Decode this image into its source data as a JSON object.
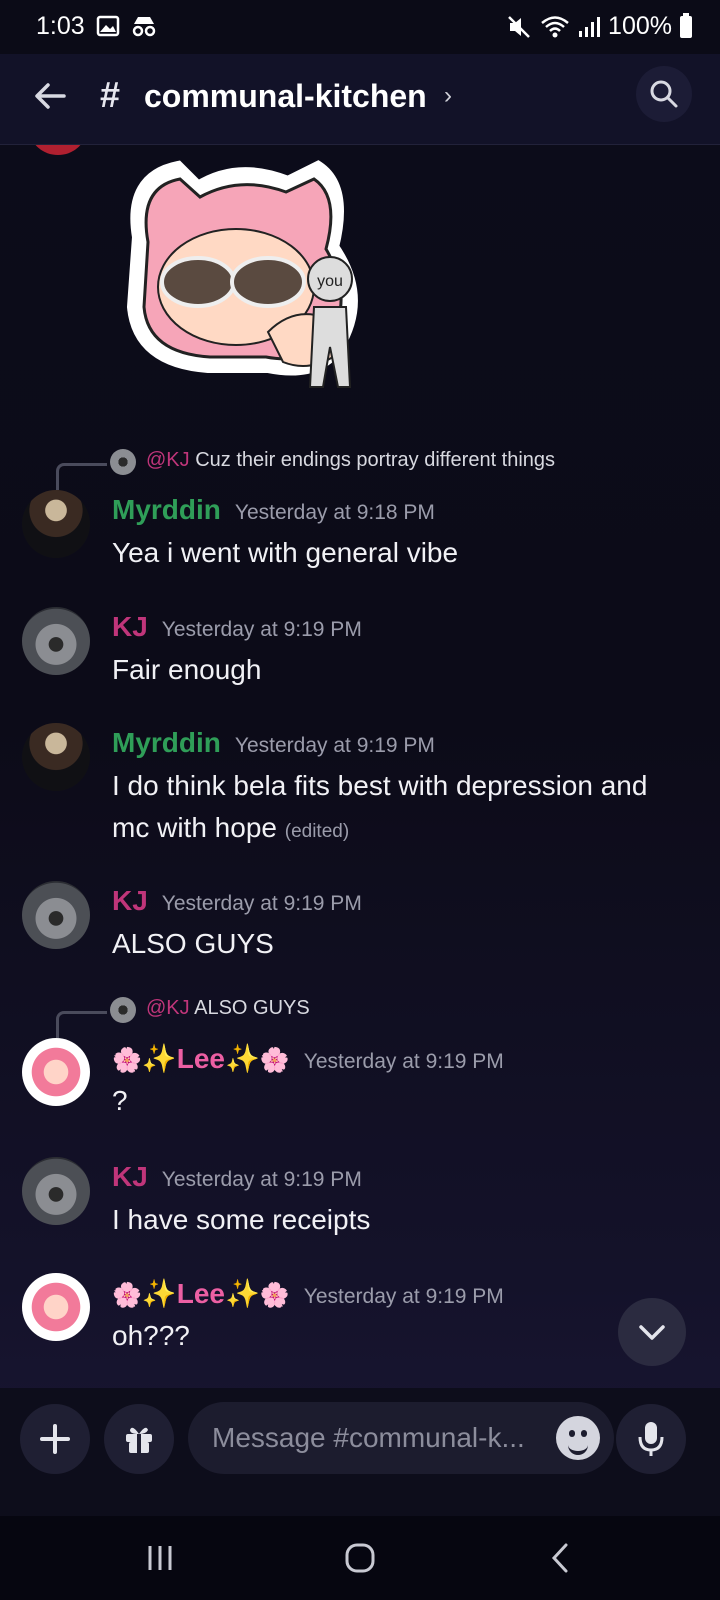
{
  "status_bar": {
    "time": "1:03",
    "battery": "100%"
  },
  "header": {
    "channel_title": "communal-kitchen",
    "hash": "#"
  },
  "messages": [
    {
      "reply": {
        "mention": "@KJ",
        "text": "Cuz their endings portray different things"
      },
      "username": "Myrddin",
      "timestamp": "Yesterday at 9:18 PM",
      "text": "Yea i went with general vibe"
    },
    {
      "username": "KJ",
      "timestamp": "Yesterday at 9:19 PM",
      "text": "Fair enough"
    },
    {
      "username": "Myrddin",
      "timestamp": "Yesterday at 9:19 PM",
      "text": "I do think bela fits best with depression and mc with hope",
      "edited": "(edited)"
    },
    {
      "username": "KJ",
      "timestamp": "Yesterday at 9:19 PM",
      "text": "ALSO GUYS"
    },
    {
      "reply": {
        "mention": "@KJ",
        "text": "ALSO GUYS"
      },
      "username": "✨Lee✨",
      "decor": "🌸",
      "timestamp": "Yesterday at 9:19 PM",
      "text": "?"
    },
    {
      "username": "KJ",
      "timestamp": "Yesterday at 9:19 PM",
      "text": "I have some receipts"
    },
    {
      "username": "✨Lee✨",
      "decor": "🌸",
      "timestamp": "Yesterday at 9:19 PM",
      "text": "oh???"
    }
  ],
  "sticker": {
    "label": "you"
  },
  "composer": {
    "placeholder": "Message #communal-k..."
  },
  "colors": {
    "myrddin": "#2f9e58",
    "kj": "#c0357a",
    "lee": "#ec5fa3",
    "background": "#0e0d1a"
  },
  "icons": [
    "back-arrow-icon",
    "hash-icon",
    "search-icon",
    "plus-icon",
    "gift-icon",
    "emoji-icon",
    "mic-icon",
    "chevron-down-icon"
  ]
}
